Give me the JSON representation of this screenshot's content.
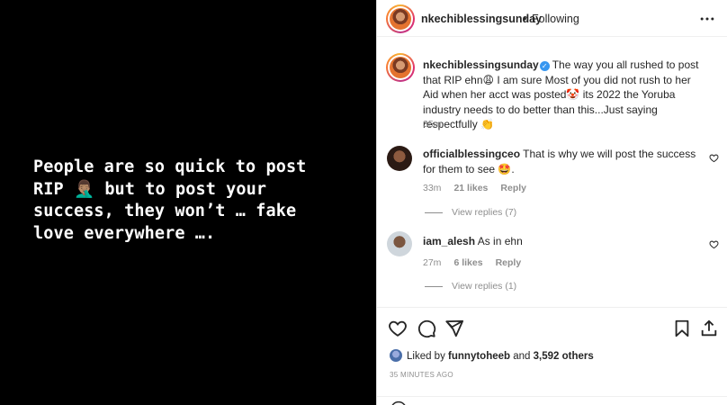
{
  "story": {
    "text": "People are so quick to post\nRIP 🤦🏽‍♂️ but to post your\nsuccess, they won’t … fake\nlove everywhere …."
  },
  "header": {
    "username": "nkechiblessingsunday",
    "separator": "•",
    "follow_status": "Following"
  },
  "caption": {
    "username": "nkechiblessingsunday",
    "text": "The way you all rushed to post that RIP ehn😩 I am sure Most of you did not rush to her Aid when her acct was posted🤡 its 2022 the Yoruba industry needs to do better than this...Just saying respectfully 👏",
    "time": "35m"
  },
  "comments": [
    {
      "username": "officialblessingceo",
      "text": "That is why we will post the success for them to see 🤩.",
      "time": "33m",
      "likes": "21 likes",
      "reply": "Reply",
      "view_replies": "View replies (7)"
    },
    {
      "username": "iam_alesh",
      "text": "As in ehn",
      "time": "27m",
      "likes": "6 likes",
      "reply": "Reply",
      "view_replies": "View replies (1)"
    }
  ],
  "footer": {
    "liked_by_prefix": "Liked by",
    "liked_by_user": "funnytoheeb",
    "liked_by_and": "and",
    "liked_by_count": "3,592 others",
    "time_ago": "35 MINUTES AGO"
  },
  "icons": {
    "more": "more-horizontal-icon",
    "heart": "heart-icon",
    "comment": "comment-icon",
    "share": "paper-plane-icon",
    "save": "bookmark-icon",
    "emoji": "smile-icon"
  },
  "colors": {
    "verified": "#3897f0",
    "muted": "#8e8e8e",
    "text": "#262626"
  }
}
